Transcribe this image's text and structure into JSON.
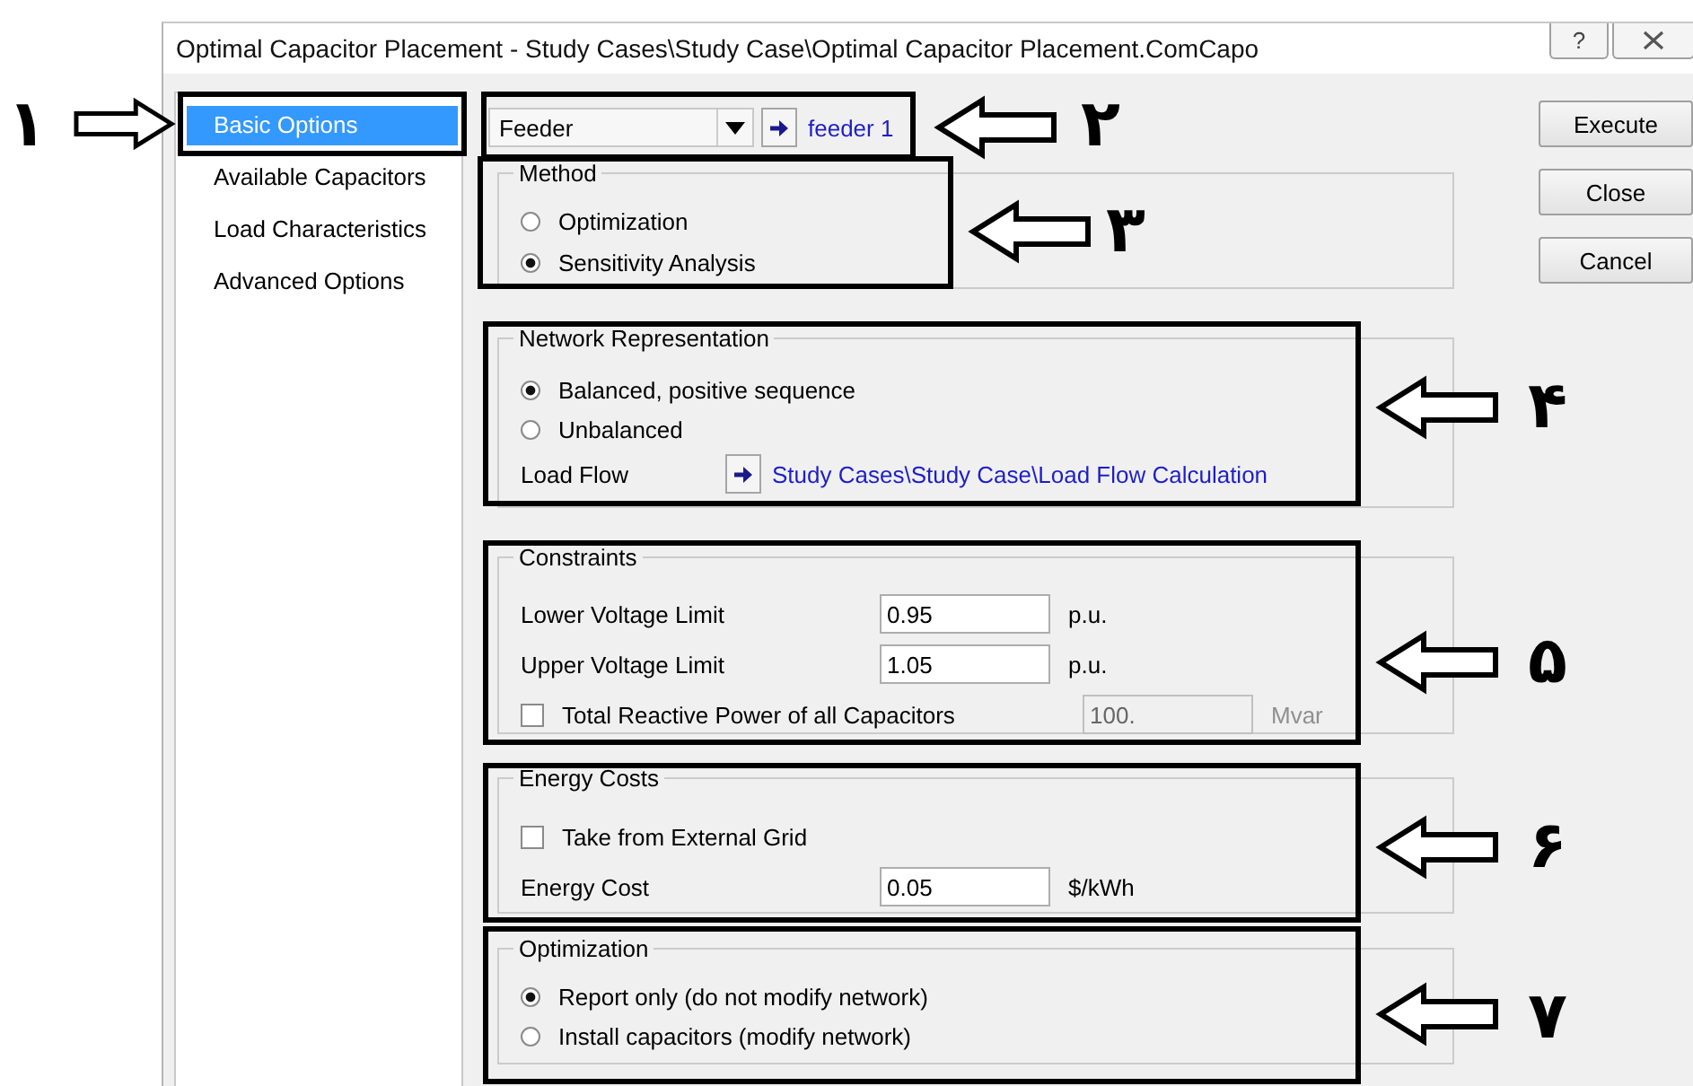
{
  "window": {
    "title": "Optimal Capacitor Placement - Study Cases\\Study Case\\Optimal Capacitor Placement.ComCapo",
    "help": "?"
  },
  "sidebar": {
    "items": [
      {
        "label": "Basic Options",
        "selected": true
      },
      {
        "label": "Available Capacitors",
        "selected": false
      },
      {
        "label": "Load Characteristics",
        "selected": false
      },
      {
        "label": "Advanced Options",
        "selected": false
      }
    ]
  },
  "feeder": {
    "label": "Feeder",
    "link": "feeder 1"
  },
  "method": {
    "title": "Method",
    "options": [
      {
        "label": "Optimization",
        "selected": false
      },
      {
        "label": "Sensitivity Analysis",
        "selected": true
      }
    ]
  },
  "network_representation": {
    "title": "Network Representation",
    "options": [
      {
        "label": "Balanced, positive sequence",
        "selected": true
      },
      {
        "label": "Unbalanced",
        "selected": false
      }
    ],
    "load_flow": {
      "label": "Load Flow",
      "link": "Study Cases\\Study Case\\Load Flow Calculation"
    }
  },
  "constraints": {
    "title": "Constraints",
    "fields": [
      {
        "label": "Lower Voltage Limit",
        "value": "0.95",
        "unit": "p.u."
      },
      {
        "label": "Upper Voltage Limit",
        "value": "1.05",
        "unit": "p.u."
      }
    ],
    "total_reactive_power": {
      "label": "Total Reactive Power of all Capacitors",
      "checked": false,
      "value": "100.",
      "unit": "Mvar",
      "disabled": true
    }
  },
  "energy_costs": {
    "title": "Energy Costs",
    "take_from_external_grid": {
      "label": "Take from External Grid",
      "checked": false
    },
    "energy_cost": {
      "label": "Energy Cost",
      "value": "0.05",
      "unit": "$/kWh"
    }
  },
  "optimization": {
    "title": "Optimization",
    "options": [
      {
        "label": "Report only (do not modify network)",
        "selected": true
      },
      {
        "label": "Install capacitors (modify network)",
        "selected": false
      }
    ]
  },
  "buttons": [
    "Execute",
    "Close",
    "Cancel"
  ],
  "annotations": [
    {
      "number": "۱"
    },
    {
      "number": "۲"
    },
    {
      "number": "۳"
    },
    {
      "number": "۴"
    },
    {
      "number": "۵"
    },
    {
      "number": "۶"
    },
    {
      "number": "۷"
    }
  ]
}
